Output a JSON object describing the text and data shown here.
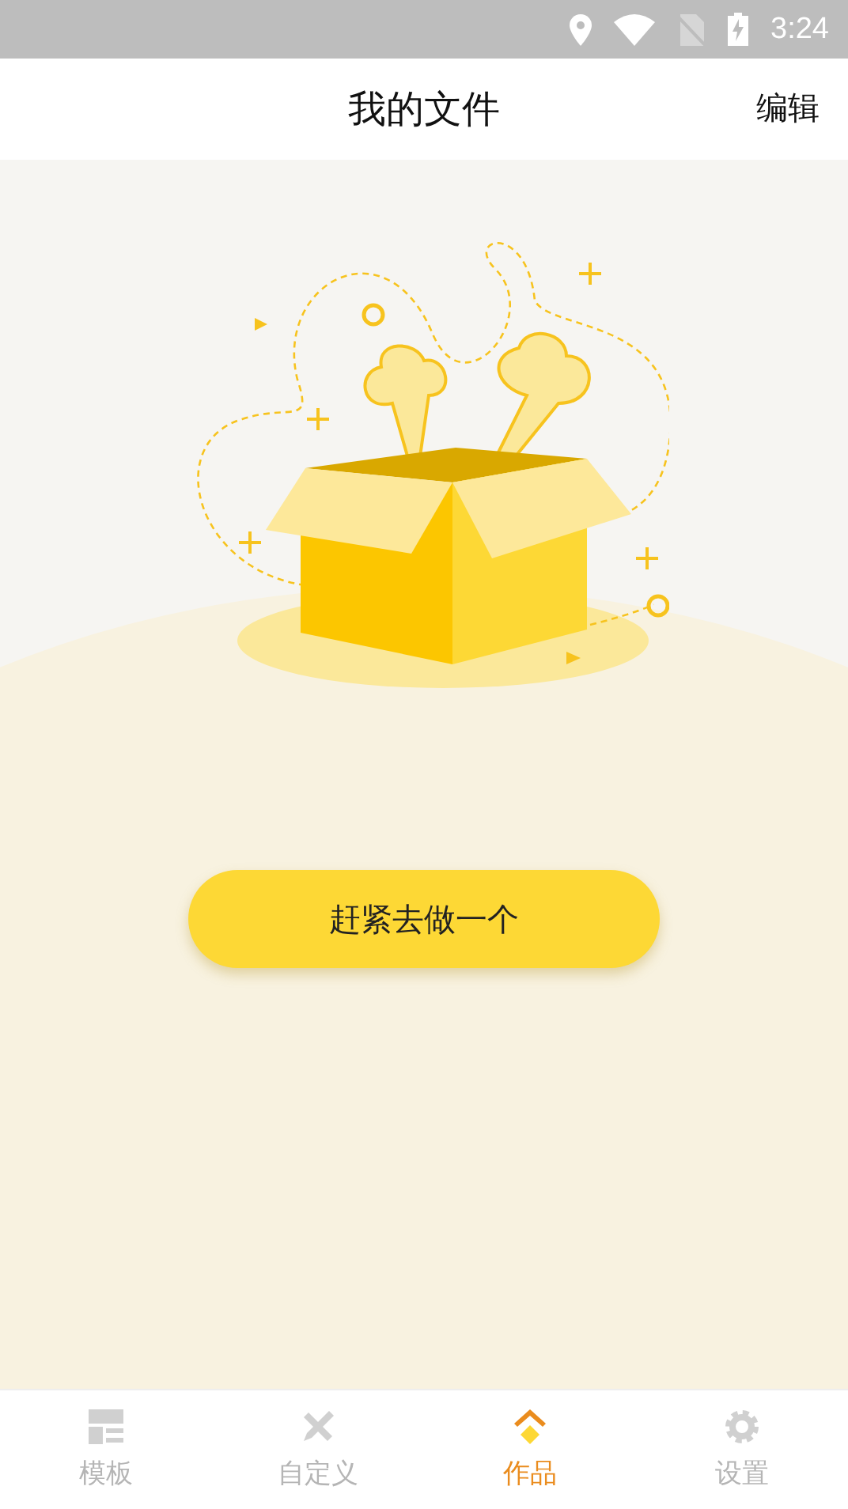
{
  "status_bar": {
    "time": "3:24"
  },
  "header": {
    "title": "我的文件",
    "action": "编辑"
  },
  "empty_state": {
    "button": "赶紧去做一个"
  },
  "tabs": [
    {
      "label": "模板",
      "kind": "template",
      "selected": false
    },
    {
      "label": "自定义",
      "kind": "custom",
      "selected": false
    },
    {
      "label": "作品",
      "kind": "works",
      "selected": true
    },
    {
      "label": "设置",
      "kind": "settings",
      "selected": false
    }
  ]
}
